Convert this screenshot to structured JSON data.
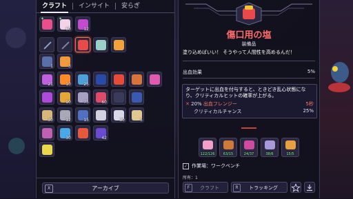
{
  "tabs": [
    {
      "label": "クラフト",
      "active": true
    },
    {
      "label": "インサイト",
      "active": false
    },
    {
      "label": "安らぎ",
      "active": false
    }
  ],
  "inventory": [
    {
      "name": "pink-plant",
      "color": "#e94f8a",
      "count": "",
      "star": true
    },
    {
      "name": "flower",
      "color": "#f2d4e6",
      "count": "60",
      "star": true
    },
    {
      "name": "berries",
      "color": "#c34bd0",
      "count": "12",
      "star": false
    },
    {
      "name": "blade",
      "color": "#8fa0c8",
      "count": "",
      "star": false
    },
    {
      "name": "staff",
      "color": "#7c86a8",
      "count": "",
      "star": false
    },
    {
      "name": "salt",
      "color": "#e94a4a",
      "count": "",
      "star": false,
      "selected": true
    },
    {
      "name": "scissors",
      "color": "#9bd0c8",
      "count": "",
      "star": false
    },
    {
      "name": "firework",
      "color": "#f2a23c",
      "count": "",
      "star": false
    },
    {
      "name": "bag",
      "color": "#5a6ea8",
      "count": "1",
      "star": false
    },
    {
      "name": "horn",
      "color": "#f29a3c",
      "count": "3",
      "star": false
    },
    {
      "name": "bug",
      "color": "#c060e0",
      "count": "21",
      "star": false
    },
    {
      "name": "fire",
      "color": "#ff8a2a",
      "count": "10",
      "star": false
    },
    {
      "name": "jar",
      "color": "#4da0d8",
      "count": "25",
      "star": false
    },
    {
      "name": "crystal",
      "color": "#2a4aa8",
      "count": "",
      "star": false
    },
    {
      "name": "apple",
      "color": "#e84a3a",
      "count": "",
      "star": false
    },
    {
      "name": "meat",
      "color": "#d8743a",
      "count": "",
      "star": false
    },
    {
      "name": "coral",
      "color": "#e05ab0",
      "count": "",
      "star": false
    },
    {
      "name": "bomb",
      "color": "#b04ad8",
      "count": "",
      "star": false
    },
    {
      "name": "sauce",
      "color": "#e4a83a",
      "count": "90",
      "star": false
    },
    {
      "name": "shell",
      "color": "#a8a0c0",
      "count": "75",
      "star": false
    },
    {
      "name": "roll",
      "color": "#e04a6a",
      "count": "60",
      "star": false
    },
    {
      "name": "rock",
      "color": "#3a3a5a",
      "count": "",
      "star": false
    },
    {
      "name": "can",
      "color": "#3a5ab0",
      "count": "",
      "star": false
    },
    {
      "name": "bread",
      "color": "#d8b87a",
      "count": "30",
      "star": false
    },
    {
      "name": "bone",
      "color": "#a8a8b8",
      "count": "12",
      "star": false
    },
    {
      "name": "glove",
      "color": "#5070c0",
      "count": "15",
      "star": false
    },
    {
      "name": "plate",
      "color": "#d0d0e0",
      "count": "",
      "star": false
    },
    {
      "name": "gears",
      "color": "#d8d8e8",
      "count": "30",
      "star": false
    },
    {
      "name": "vase",
      "color": "#e0c890",
      "count": "5",
      "star": false
    },
    {
      "name": "card",
      "color": "#c060b0",
      "count": "",
      "star": false
    },
    {
      "name": "key",
      "color": "#4aa8e8",
      "count": "30",
      "star": false
    },
    {
      "name": "leaf",
      "color": "#e8583a",
      "count": "",
      "star": false
    },
    {
      "name": "scroll",
      "color": "#6a4ad0",
      "count": "42",
      "star": false
    },
    {
      "name": "wand",
      "color": "#e8d84a",
      "count": "",
      "star": false
    }
  ],
  "archive": {
    "key": "X",
    "label": "アーカイブ"
  },
  "item": {
    "title": "傷口用の塩",
    "category": "装備品",
    "description": "塗り込めばいい！ そうやって人間性を高めるんだ！",
    "stat": {
      "label": "出血効果",
      "value": "5%"
    },
    "effect_desc": "ターゲットに出血を付与すると、ときどき乱心状態になり、クリティカルヒットの確率が上がる。",
    "effect_a": {
      "percent": "20%",
      "label": "出血フレンジー",
      "value": "5秒"
    },
    "effect_b": {
      "label": "クリティカルチャンス",
      "value": "25%"
    }
  },
  "materials": [
    {
      "name": "material-flower",
      "color": "#f2a0c8",
      "count": "122/126"
    },
    {
      "name": "material-meat",
      "color": "#d07a3a",
      "count": "63/15"
    },
    {
      "name": "material-bug",
      "color": "#d04aa0",
      "count": "24/37"
    },
    {
      "name": "material-shell",
      "color": "#a89ad8",
      "count": "38/6"
    },
    {
      "name": "material-crystal",
      "color": "#e8a040",
      "count": "15/5"
    }
  ],
  "workbench": "作業場：ワークベンチ",
  "owned": "所有：1",
  "buttons": {
    "craft": {
      "key": "F",
      "label": "クラフト"
    },
    "tracking": {
      "key": "R",
      "label": "トラッキング"
    }
  },
  "colors": {
    "accent": "#ff6b4a",
    "title": "#ff6b6b",
    "panel": "#12111e"
  }
}
